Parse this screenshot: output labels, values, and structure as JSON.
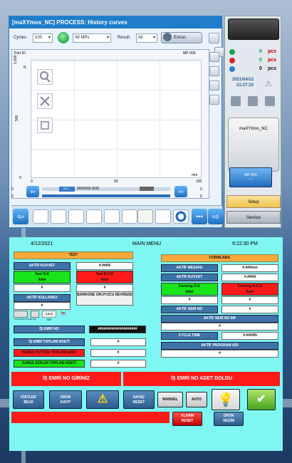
{
  "window": {
    "title": "[maXYmos_NC] PROCESS: History curves",
    "cycles_label": "Cycles",
    "cycles_value": "100",
    "mps_value": "All MPs",
    "result_label": "Result",
    "result_value": "All",
    "extras_label": "Extras",
    "part_id_label": "Part ID :",
    "mp_label": "MP-000",
    "y_unit": "N",
    "y_ticks": [
      "1,000",
      "500",
      "0"
    ],
    "x_unit": "mm",
    "x_ticks": [
      "0",
      "50",
      "100"
    ],
    "slider_left_top": "0",
    "slider_right_top": "0",
    "slider_left_bottom": "0",
    "slider_right_bottom": "0",
    "slider_mp_tag": "MP---",
    "slider_counter": "0000000 (0/0)"
  },
  "right_panel": {
    "counts": [
      {
        "value": "0",
        "unit": "pcs",
        "color": "#1aa34a"
      },
      {
        "value": "0",
        "unit": "pcs",
        "color": "#d42323"
      },
      {
        "value": "0",
        "unit": "pcs",
        "color": "#2a7fd0"
      }
    ],
    "date": "2021/04/12",
    "time": "21:27:23",
    "device_name": "maXYmos_NC",
    "mp_name": "MP-000",
    "mp_sub": "-----",
    "setup_label": "Setup",
    "service_label": "Service"
  },
  "hmi": {
    "date": "4/12/2021",
    "menu": "MAIN MENU",
    "time": "9:22:30 PM",
    "test_header": "TEST",
    "aktif_kuvvet_label": "AKTİF KUVVET",
    "aktif_kuvvet_value": "#.##kN",
    "test_ok_label": "Test O.K\nAdet",
    "test_nok_label": "Test N.O.K\nAdet",
    "test_ok_value": "#",
    "test_nok_value": "#",
    "aktif_kullanici_label": "AKTİF KULLANICI",
    "aktif_kullanici_value": "#",
    "barkode_label": "BARKODE OKUYUCU DEVREDE",
    "kullanici_ayarlari": "KULLANICI AYARLARI",
    "cikis_label": "ÇIKIŞ YAP",
    "is_emri_no_label": "İŞ EMRİ NO",
    "is_emri_no_value": "####################",
    "is_emri_toplam_label": "İŞ EMRİ TOPLAM ADETİ",
    "is_emri_toplam_value": "#",
    "hurda_label": "HURDA KUTUSU TOPLAM ADET",
    "hurda_value": "#",
    "kabul_label": "KABUL EDİLEN TOPLAM ADETİ",
    "kabul_value": "#",
    "formlama_header": "FORMLAMA",
    "aktif_mesafe_label": "AKTİF MESAFE",
    "aktif_mesafe_value": "#.###mm",
    "f_aktif_kuvvet_label": "AKTİF KUVVET",
    "f_aktif_kuvvet_value": "#.##kN",
    "forming_ok_label": "Forming O.K\nAdet",
    "forming_nok_label": "Forming N.O.K\nAdet",
    "forming_ok_value": "#",
    "forming_nok_value": "#",
    "aktif_seri_no_label": "AKTİF SERİ NO",
    "aktif_seri_no_value": "#",
    "aktif_seri_no_mp_label": "AKTİF SERİ NO MP",
    "aktif_seri_no_mp_value": "#",
    "cycle_time_label": "CYCLE TIME",
    "cycle_time_value": "#.###SN",
    "aktif_program_label": "AKTİF PROGRAM ADI",
    "aktif_program_value": "#",
    "alarm_left": "İŞ EMRİ NO GİRİNİZ",
    "alarm_right": "İŞ EMRİ NO ADET DOLDU",
    "btn_kistler": "KİSTLER\nBİLGİ",
    "btn_urun_kayit": "ÜRÜN\nKAYIT",
    "btn_sayac": "SAYAÇ\nRESET",
    "btn_manuel": "MANUEL",
    "btn_auto": "AUTO",
    "btn_alarm_reset": "ALARM\nRESET",
    "btn_urun_secim": "ÜRÜN\nSEÇİM"
  }
}
